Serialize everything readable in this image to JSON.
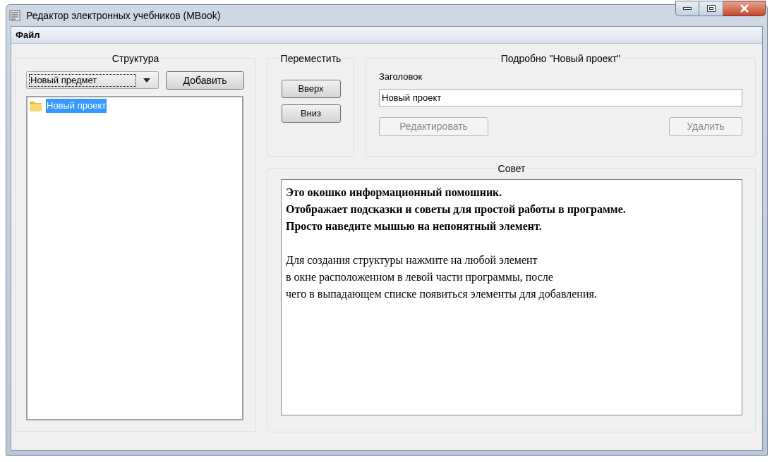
{
  "window": {
    "title": "Редактор электронных учебников (MBook)"
  },
  "menu": [
    "Файл"
  ],
  "structure": {
    "title": "Структура",
    "dropdown": {
      "value": "Новый предмет"
    },
    "add_button": "Добавить",
    "tree": [
      {
        "label": "Новый проект",
        "selected": true
      }
    ]
  },
  "move": {
    "title": "Переместить",
    "buttons": [
      "Вверх",
      "Вниз"
    ]
  },
  "details": {
    "title": "Подробно \"Новый проект\"",
    "field_label": "Заголовок",
    "field_value": "Новый проект",
    "buttons": [
      {
        "label": "Редактировать",
        "disabled": true
      },
      {
        "label": "Удалить",
        "disabled": true
      }
    ]
  },
  "tip": {
    "title": "Совет",
    "paragraphs": [
      {
        "bold": true,
        "lines": [
          "Это окошко информационный помошник.",
          "Отображает подсказки и советы для простой работы в программе.",
          "Просто наведите мышью на непонятный элемент."
        ]
      },
      {
        "bold": false,
        "lines": [
          "Для создания структуры нажмите на любой элемент",
          "в окне расположенном в левой части программы, после",
          "чего в выпадающем списке появиться элементы для добавления."
        ]
      }
    ]
  }
}
